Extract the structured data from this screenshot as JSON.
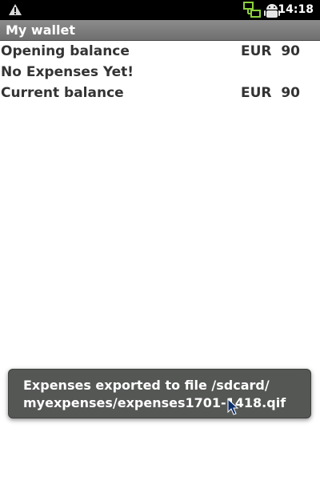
{
  "status_bar": {
    "time": "14:18",
    "icons": [
      "warning-icon",
      "network-sync-icon",
      "android-debug-icon"
    ]
  },
  "app": {
    "title": "My wallet"
  },
  "rows": [
    {
      "label": "Opening balance",
      "amount": "EUR  90"
    },
    {
      "label": "No Expenses Yet!",
      "amount": ""
    },
    {
      "label": "Current balance",
      "amount": "EUR  90"
    }
  ],
  "toast": {
    "line1": "Expenses exported to file /sdcard/",
    "line2": "myexpenses/expenses1701-1418.qif"
  },
  "colors": {
    "status_bar_bg": "#000000",
    "title_bar_bg": "#7d7d7d",
    "text": "#333333",
    "toast_bg": "#545754",
    "network_icon": "#8ccf3c"
  }
}
